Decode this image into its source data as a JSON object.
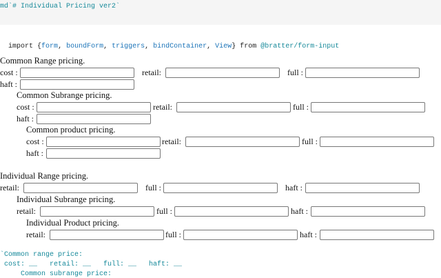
{
  "md_cell": {
    "text": "md`# Individual Pricing ver2`"
  },
  "import_cell": {
    "keyword_import": "import",
    "open_brace": " {",
    "names": [
      "form",
      "boundForm",
      "triggers",
      "bindContainer",
      "View"
    ],
    "close_brace": "}",
    "keyword_from": " from ",
    "module": "@bratter/form-input"
  },
  "form": {
    "common_range": {
      "heading": "Common Range pricing.",
      "cost_label": "cost :",
      "retail_label": "retail:",
      "full_label": "full :",
      "haft_label": "haft :"
    },
    "common_subrange": {
      "heading": "Common Subrange pricing.",
      "cost_label": "cost :",
      "retail_label": "retail:",
      "full_label": "full :",
      "haft_label": "haft :"
    },
    "common_product": {
      "heading": "Common product pricing.",
      "cost_label": "cost :",
      "retail_label": "retail:",
      "full_label": "full :",
      "haft_label": "haft :"
    },
    "individual_range": {
      "heading": "Individual Range pricing.",
      "retail_label": "retail:",
      "full_label": "full :",
      "haft_label": "haft :"
    },
    "individual_subrange": {
      "heading": "Individual Subrange pricing.",
      "retail_label": "retail:",
      "full_label": "full :",
      "haft_label": "haft :"
    },
    "individual_product": {
      "heading": "Individual Product pricing.",
      "retail_label": "retail:",
      "full_label": "full :",
      "haft_label": "haft :"
    }
  },
  "output_cell": {
    "line1": "`Common range price:",
    "line2": " cost: __   retail: __   full: __   haft: __",
    "line3": "     Common subrange price:"
  },
  "colors": {
    "code_keyword": "#222222",
    "code_identifier": "#1a73b8",
    "code_string": "#16899a",
    "cell_background": "#f5f5f5"
  }
}
